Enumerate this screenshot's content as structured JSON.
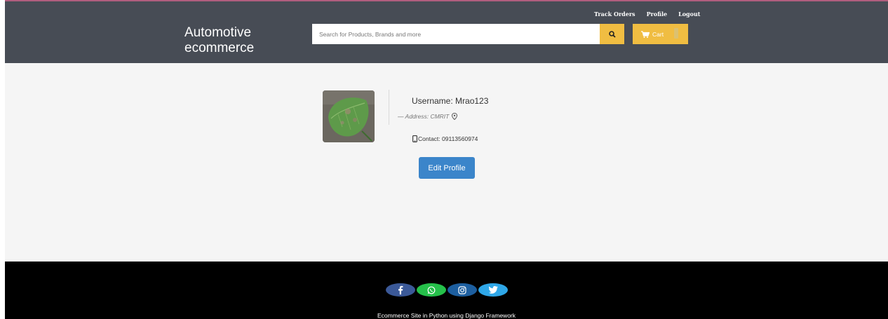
{
  "header": {
    "brand_line1": "Automotive",
    "brand_line2": "ecommerce",
    "links": [
      "Track Orders",
      "Profile",
      "Logout"
    ],
    "search_placeholder": "Search for Products, Brands and more",
    "cart_label": "Cart"
  },
  "profile": {
    "username": "Username: Mrao123",
    "address": "— Address: CMRIT",
    "contact": "Contact: 09113560974",
    "edit_label": "Edit Profile"
  },
  "footer": {
    "text": "Ecommerce Site in Python using Django Framework",
    "socials": [
      "facebook-icon",
      "whatsapp-icon",
      "instagram-icon",
      "twitter-icon"
    ]
  },
  "colors": {
    "navbar": "#474c55",
    "accent": "#f0bd42",
    "button": "#3b85ca",
    "footer": "#000000"
  }
}
